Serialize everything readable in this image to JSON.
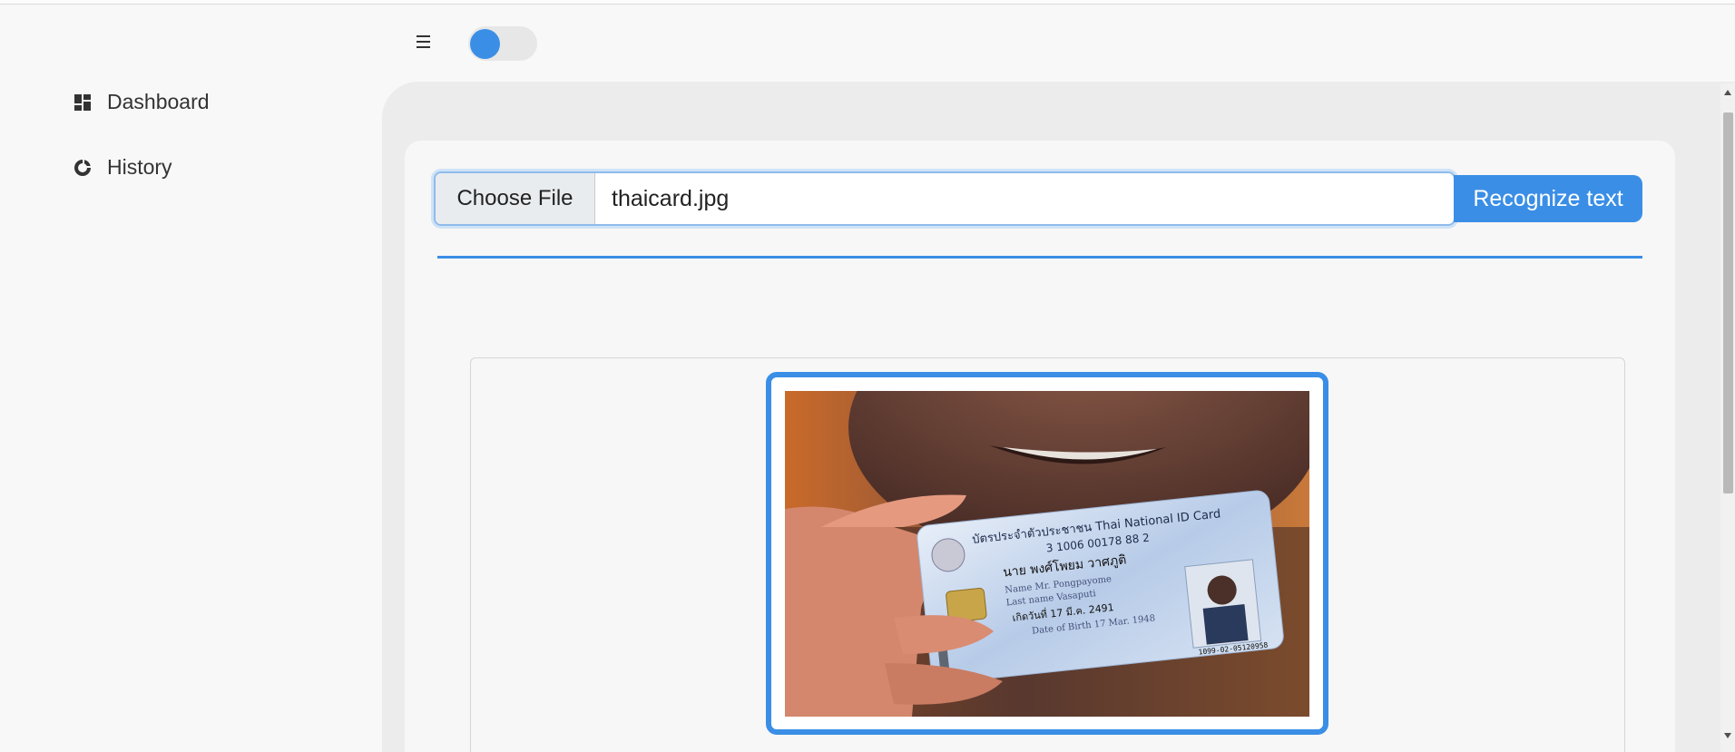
{
  "header": {
    "menu_icon": "hamburger-menu-icon",
    "theme_toggle": {
      "state": "off",
      "accent": "#3a8ee6"
    }
  },
  "sidebar": {
    "items": [
      {
        "label": "Dashboard",
        "icon": "dashboard-grid-icon"
      },
      {
        "label": "History",
        "icon": "history-circle-icon"
      }
    ]
  },
  "upload": {
    "choose_label": "Choose File",
    "file_name": "thaicard.jpg",
    "recognize_label": "Recognize text"
  },
  "preview": {
    "card_lines": [
      "บัตรประจำตัวประชาชน Thai National ID Card",
      "3 1006 00178 88 2",
      "นาย พงศ์โพยม วาศภูติ",
      "Name Mr. Pongpayome",
      "Last name Vasaputi",
      "เกิดวันที่ 17 มี.ค. 2491",
      "Date of Birth 17 Mar. 1948",
      "1099-02-05120958"
    ]
  },
  "colors": {
    "accent": "#3a8ee6",
    "page_bg": "#f8f8f8",
    "panel_bg": "#ececec"
  }
}
